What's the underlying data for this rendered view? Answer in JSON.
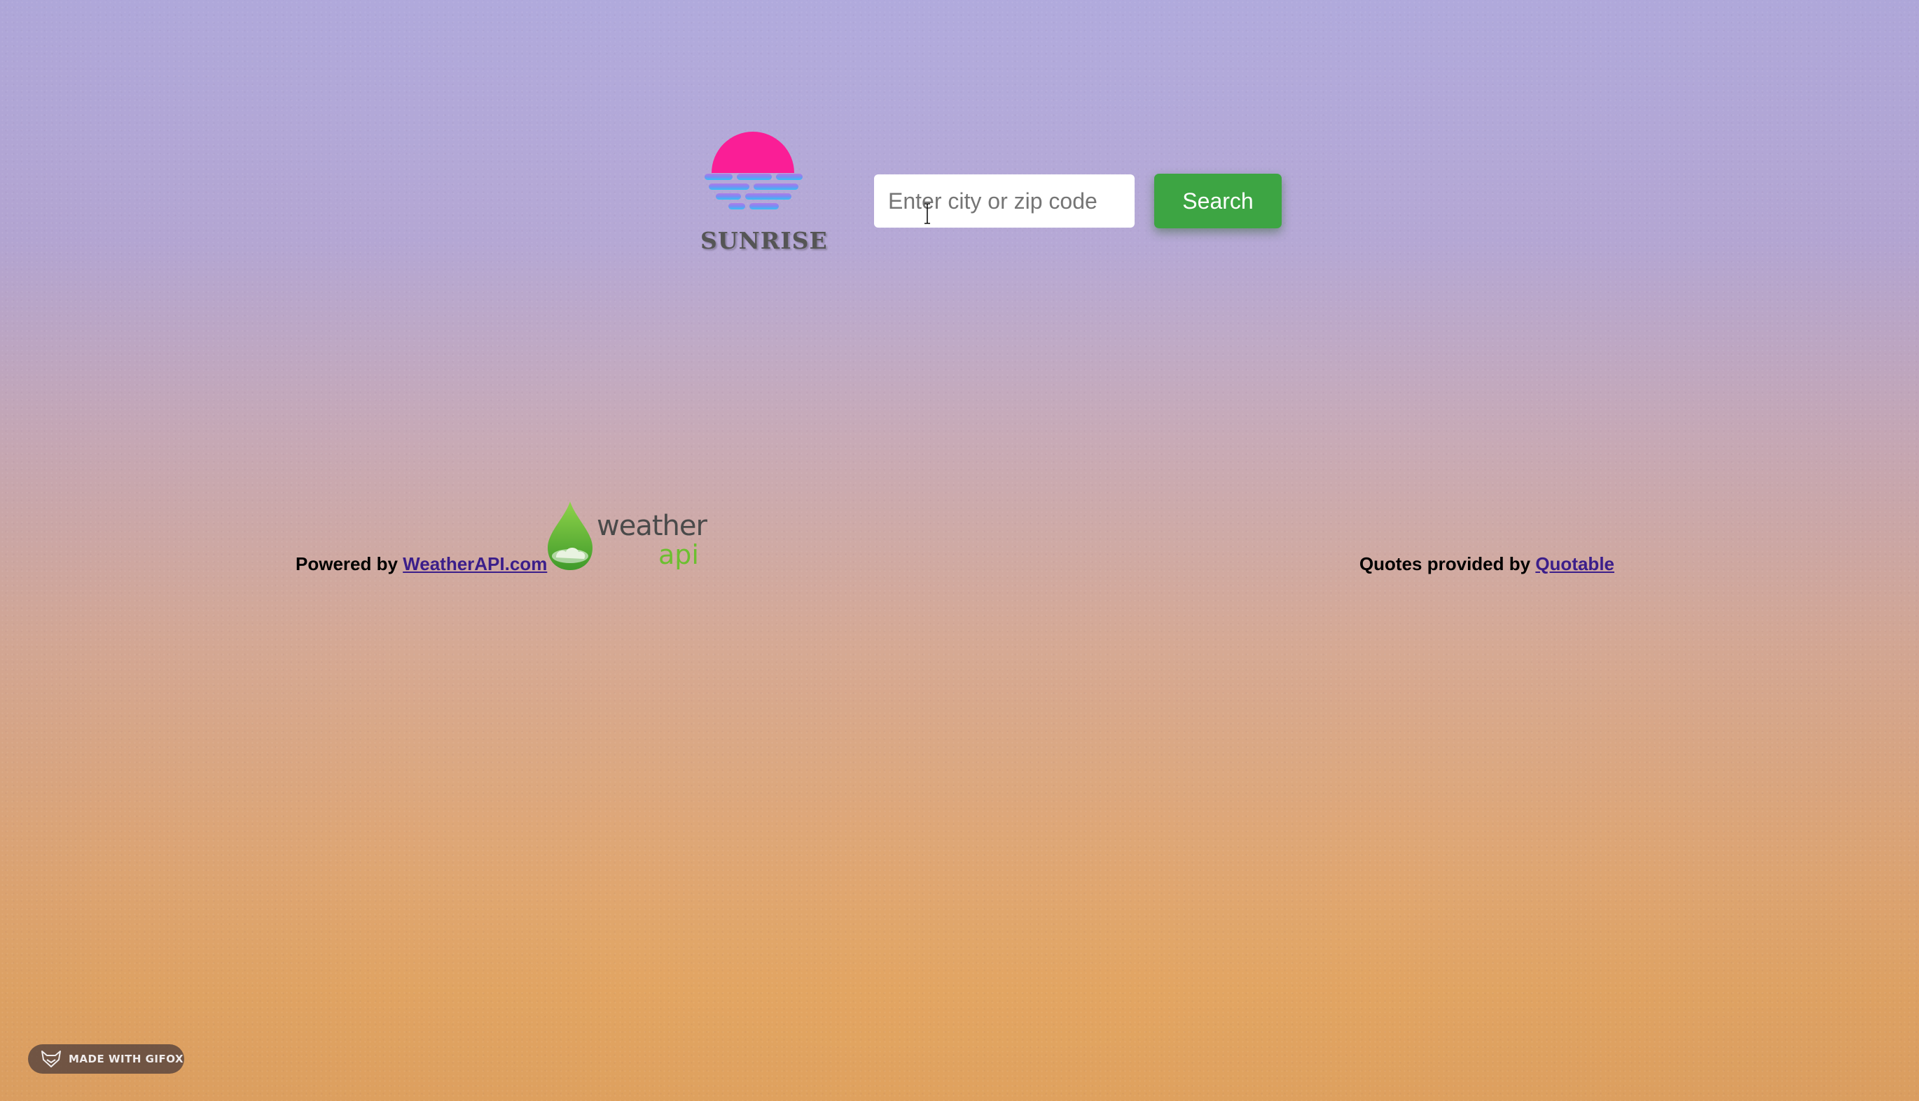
{
  "header": {
    "logo_text": "SUNRISE",
    "logo_icon": "sunset-icon",
    "logo_colors": [
      "#fa1e96",
      "#9a7bf0",
      "#4fb8f2"
    ]
  },
  "search": {
    "placeholder": "Enter city or zip code",
    "value": "",
    "button_label": "Search",
    "button_color": "#3da543"
  },
  "footer": {
    "weather_prefix": "Powered by",
    "weather_link": "WeatherAPI.com",
    "weather_logo_word": "weather",
    "weather_logo_api": "api",
    "quotes_prefix": "Quotes provided by",
    "quotes_link": "Quotable"
  },
  "badge": {
    "text": "MADE WITH GIFOX",
    "icon": "fox-icon"
  }
}
